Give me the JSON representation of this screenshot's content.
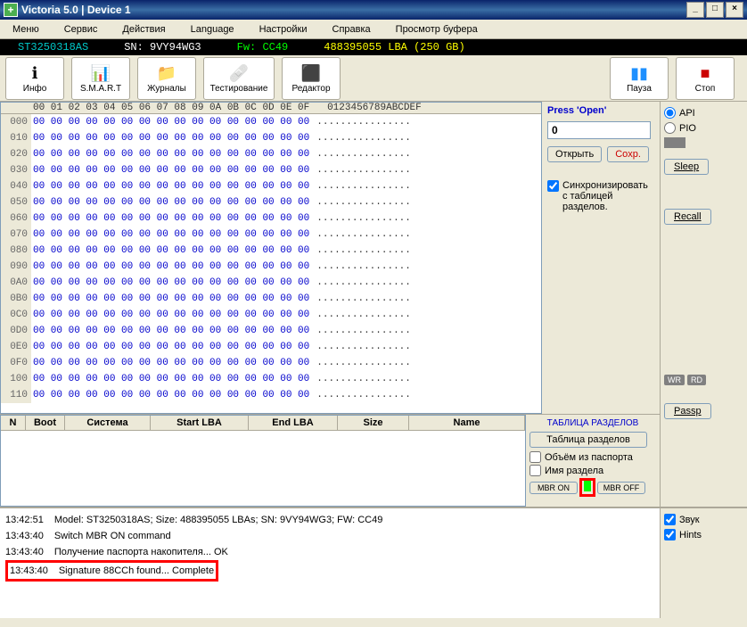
{
  "titlebar": {
    "title": "Victoria 5.0 | Device 1"
  },
  "menubar": [
    "Меню",
    "Сервис",
    "Действия",
    "Language",
    "Настройки",
    "Справка",
    "Просмотр буфера"
  ],
  "infobar": {
    "model": "ST3250318AS",
    "sn": "SN: 9VY94WG3",
    "fw": "Fw: CC49",
    "lba": "488395055 LBA (250 GB)"
  },
  "toolbar": {
    "info": "Инфо",
    "smart": "S.M.A.R.T",
    "journals": "Журналы",
    "test": "Тестирование",
    "editor": "Редактор",
    "pause": "Пауза",
    "stop": "Стоп"
  },
  "hex": {
    "header_hex": "00 01 02 03 04 05 06 07 08 09 0A 0B 0C 0D 0E 0F",
    "header_ascii": "0123456789ABCDEF",
    "offsets": [
      "000",
      "010",
      "020",
      "030",
      "040",
      "050",
      "060",
      "070",
      "080",
      "090",
      "0A0",
      "0B0",
      "0C0",
      "0D0",
      "0E0",
      "0F0",
      "100",
      "110"
    ],
    "byteline": "00 00 00 00 00 00 00 00 00 00 00 00 00 00 00 00",
    "asciiline": "................"
  },
  "side": {
    "prompt": "Press 'Open'",
    "value": "0",
    "open": "Открыть",
    "save": "Coxp.",
    "sync": "Синхронизировать с таблицей разделов."
  },
  "part_table": {
    "cols": {
      "n": "N",
      "boot": "Boot",
      "system": "Система",
      "start": "Start LBA",
      "end": "End LBA",
      "size": "Size",
      "name": "Name"
    }
  },
  "part_side": {
    "title": "ТАБЛИЦА РАЗДЕЛОВ",
    "btn": "Таблица разделов",
    "vol": "Объём из паспорта",
    "name": "Имя раздела",
    "mbr_on": "MBR ON",
    "mbr_off": "MBR OFF"
  },
  "right": {
    "api": "API",
    "pio": "PIO",
    "sleep": "Sleep",
    "recall": "Recall",
    "wr": "WR",
    "rd": "RD",
    "passp": "Passp"
  },
  "log": {
    "lines": [
      {
        "ts": "13:42:51",
        "msg": "Model: ST3250318AS; Size: 488395055 LBAs; SN: 9VY94WG3; FW: CC49",
        "blue": false
      },
      {
        "ts": "13:43:40",
        "msg": "Switch MBR ON command",
        "blue": false
      },
      {
        "ts": "13:43:40",
        "msg": "Получение паспорта накопителя... OK",
        "blue": false
      },
      {
        "ts": "13:43:40",
        "msg": "Signature 88CCh found... Complete",
        "blue": true
      }
    ],
    "sound": "Звук",
    "hints": "Hints"
  }
}
